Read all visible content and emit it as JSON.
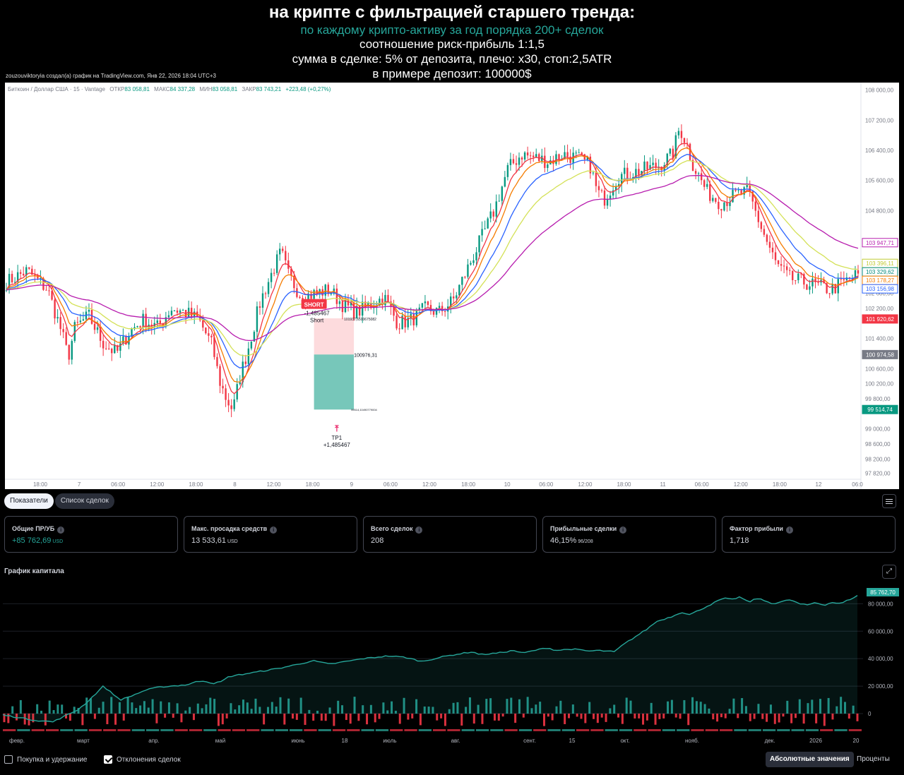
{
  "header": {
    "title": "на крипте с фильтрацией старшего тренда:",
    "subtitle": "по каждому крипто-активу за год порядка 200+ сделок",
    "line1": "соотношение риск-прибыль 1:1,5",
    "line2": "сумма в сделке: 5% от депозита, плечо: x30, стоп:2,5ATR",
    "line3": "в примере депозит: 100000$",
    "attribution": "zouzouviktoryia создал(а) график на TradingView.com, Янв 22, 2026 18:04 UTC+3"
  },
  "legend": {
    "symbol": "Биткоин / Доллар США · 15 · Vantage",
    "open_label": "ОТКР",
    "open": "83 058,81",
    "high_label": "МАКС",
    "high": "84 337,28",
    "low_label": "МИН",
    "low": "83 058,81",
    "close_label": "ЗАКР",
    "close": "83 743,21",
    "change": "+223,48 (+0,27%)"
  },
  "colors": {
    "up": "#089981",
    "down": "#f23645",
    "ema_fast": "#f57c00",
    "ema_mid": "#2962ff",
    "ema_yellow": "#d4e157",
    "ema_slow": "#b71cae",
    "equity": "#26a69a",
    "trade_marker": "#e91e63"
  },
  "chart_data": [
    {
      "type": "line",
      "kind": "candlestick_with_moving_averages",
      "y_ticks": [
        "108 000,00",
        "107 200,00",
        "106 400,00",
        "105 600,00",
        "104 800,00",
        "102 600,00",
        "102 200,00",
        "101 400,00",
        "100 600,00",
        "100 200,00",
        "99 800,00",
        "99 000,00",
        "98 600,00",
        "98 200,00",
        "97 820,00"
      ],
      "y_range": [
        97700,
        108050
      ],
      "x_ticks": [
        "18:00",
        "7",
        "06:00",
        "12:00",
        "18:00",
        "8",
        "12:00",
        "18:00",
        "9",
        "06:00",
        "12:00",
        "18:00",
        "10",
        "06:00",
        "12:00",
        "18:00",
        "11",
        "06:00",
        "12:00",
        "18:00",
        "12",
        "06:0"
      ],
      "close_path": [
        [
          0,
          102900
        ],
        [
          3,
          103200
        ],
        [
          6,
          102700
        ],
        [
          8,
          101600
        ],
        [
          9,
          100900
        ],
        [
          10,
          101700
        ],
        [
          12,
          102000
        ],
        [
          14,
          101300
        ],
        [
          16,
          101000
        ],
        [
          18,
          101600
        ],
        [
          20,
          101900
        ],
        [
          22,
          101700
        ],
        [
          24,
          102200
        ],
        [
          26,
          102100
        ],
        [
          28,
          101900
        ],
        [
          30,
          101200
        ],
        [
          31,
          100300
        ],
        [
          32,
          99800
        ],
        [
          33,
          99500
        ],
        [
          34,
          100400
        ],
        [
          35,
          101000
        ],
        [
          37,
          102400
        ],
        [
          39,
          103300
        ],
        [
          40,
          103700
        ],
        [
          41,
          103100
        ],
        [
          43,
          102500
        ],
        [
          45,
          102600
        ],
        [
          47,
          102700
        ],
        [
          49,
          102300
        ],
        [
          51,
          102100
        ],
        [
          53,
          102300
        ],
        [
          55,
          102500
        ],
        [
          57,
          101800
        ],
        [
          59,
          101900
        ],
        [
          61,
          102200
        ],
        [
          63,
          102100
        ],
        [
          65,
          102400
        ],
        [
          67,
          103200
        ],
        [
          69,
          104000
        ],
        [
          71,
          104800
        ],
        [
          73,
          105900
        ],
        [
          75,
          106300
        ],
        [
          77,
          106200
        ],
        [
          79,
          106100
        ],
        [
          81,
          106300
        ],
        [
          83,
          106200
        ],
        [
          85,
          106000
        ],
        [
          86,
          105300
        ],
        [
          87,
          105100
        ],
        [
          89,
          105700
        ],
        [
          91,
          105800
        ],
        [
          93,
          105900
        ],
        [
          95,
          106000
        ],
        [
          97,
          106300
        ],
        [
          98,
          107000
        ],
        [
          99,
          106600
        ],
        [
          100,
          106000
        ],
        [
          102,
          105300
        ],
        [
          104,
          105000
        ],
        [
          106,
          105200
        ],
        [
          108,
          105300
        ],
        [
          110,
          104300
        ],
        [
          112,
          103400
        ],
        [
          114,
          103000
        ],
        [
          116,
          102900
        ],
        [
          118,
          102800
        ],
        [
          120,
          102700
        ],
        [
          122,
          102900
        ],
        [
          124,
          103100
        ]
      ],
      "line_labels": [
        {
          "text": "103 947,71",
          "key": "ema_slow",
          "value": 103947.71
        },
        {
          "text": "103 396,11",
          "key": "ema_yellow",
          "value": 103396.11
        },
        {
          "text": "103 329,62",
          "key": "ema_fast_cyan",
          "value": 103329.62
        },
        {
          "text": "103 178,27",
          "key": "ema_fast",
          "value": 103178.27
        },
        {
          "text": "103 156,98",
          "key": "ema_mid",
          "value": 103156.98
        },
        {
          "text": "101 920,62",
          "key": "down",
          "value": 101920.62
        },
        {
          "text": "100 974,58",
          "key": "neutral",
          "value": 100974.58
        },
        {
          "text": "99 514,74",
          "key": "up",
          "value": 99514.74
        }
      ],
      "trade": {
        "signal_label": "SHORT",
        "entry_text": "-1,485467",
        "entry_sub": "Short",
        "upper_text": "101937,6500675082",
        "mid_text": "100976,31",
        "lower_text": "99514,10490779004",
        "tp_label": "TP1",
        "tp_value": "+1,485467"
      }
    },
    {
      "type": "bar",
      "kind": "equity_curve_with_trade_deviation_bars",
      "y_ticks": [
        "80 000,00",
        "60 000,00",
        "40 000,00",
        "20 000,00",
        "0"
      ],
      "y_range": [
        -10000,
        92000
      ],
      "last_value_label": "85 762,70",
      "x_ticks": [
        "февр.",
        "март",
        "апр.",
        "май",
        "июнь",
        "18",
        "июль",
        "авг.",
        "сент.",
        "15",
        "окт.",
        "нояб.",
        "дек.",
        "2026",
        "20"
      ],
      "equity_points": [
        [
          0,
          -1000
        ],
        [
          2,
          -3000
        ],
        [
          4,
          -5000
        ],
        [
          6,
          -6000
        ],
        [
          7,
          -3000
        ],
        [
          8,
          0
        ],
        [
          9,
          3000
        ],
        [
          10,
          8000
        ],
        [
          11,
          14000
        ],
        [
          12,
          20000
        ],
        [
          13,
          15000
        ],
        [
          14,
          10000
        ],
        [
          15,
          12000
        ],
        [
          17,
          17000
        ],
        [
          18,
          18500
        ],
        [
          19,
          19500
        ],
        [
          20,
          20000
        ],
        [
          21,
          20500
        ],
        [
          22,
          21000
        ],
        [
          23,
          23000
        ],
        [
          24,
          24000
        ],
        [
          25,
          22000
        ],
        [
          26,
          23000
        ],
        [
          27,
          27000
        ],
        [
          30,
          30000
        ],
        [
          33,
          33000
        ],
        [
          36,
          37000
        ],
        [
          37,
          38500
        ],
        [
          39,
          36000
        ],
        [
          40,
          37000
        ],
        [
          43,
          40000
        ],
        [
          46,
          42000
        ],
        [
          48,
          41000
        ],
        [
          50,
          38000
        ],
        [
          53,
          42000
        ],
        [
          56,
          45000
        ],
        [
          57,
          43000
        ],
        [
          59,
          44000
        ],
        [
          61,
          46000
        ],
        [
          62,
          44000
        ],
        [
          65,
          48000
        ],
        [
          66,
          46000
        ],
        [
          68,
          47000
        ],
        [
          70,
          45500
        ],
        [
          71,
          46000
        ],
        [
          73,
          45000
        ],
        [
          74,
          50000
        ],
        [
          76,
          58000
        ],
        [
          77,
          62000
        ],
        [
          78,
          67000
        ],
        [
          80,
          71000
        ],
        [
          81,
          74000
        ],
        [
          82,
          72000
        ],
        [
          83,
          75000
        ],
        [
          84,
          78000
        ],
        [
          86,
          84000
        ],
        [
          87,
          83000
        ],
        [
          88,
          85000
        ],
        [
          89,
          81000
        ],
        [
          90,
          84000
        ],
        [
          92,
          80000
        ],
        [
          94,
          83000
        ],
        [
          95,
          80000
        ],
        [
          96,
          79000
        ],
        [
          97,
          81000
        ],
        [
          98,
          79000
        ],
        [
          99,
          81000
        ],
        [
          100,
          80000
        ],
        [
          101,
          83000
        ],
        [
          102,
          85762.7
        ]
      ]
    }
  ],
  "tabs": [
    {
      "label": "Показатели",
      "active": true
    },
    {
      "label": "Список сделок",
      "active": false
    }
  ],
  "stats": [
    {
      "label": "Общие ПР/УБ",
      "value": "+85 762,69",
      "suffix": "USD",
      "positive": true
    },
    {
      "label": "Макс. просадка средств",
      "value": "13 533,61",
      "suffix": "USD",
      "positive": false
    },
    {
      "label": "Всего сделок",
      "value": "208",
      "suffix": "",
      "positive": false
    },
    {
      "label": "Прибыльные сделки",
      "value": "46,15%",
      "suffix": "96/208",
      "positive": false
    },
    {
      "label": "Фактор прибыли",
      "value": "1,718",
      "suffix": "",
      "positive": false
    }
  ],
  "equity_title": "График капитала",
  "footer": {
    "buy_hold": {
      "label": "Покупка и удержание",
      "checked": false
    },
    "trade_dev": {
      "label": "Отклонения сделок",
      "checked": true
    },
    "abs_label": "Абсолютные значения",
    "pct_label": "Проценты"
  }
}
